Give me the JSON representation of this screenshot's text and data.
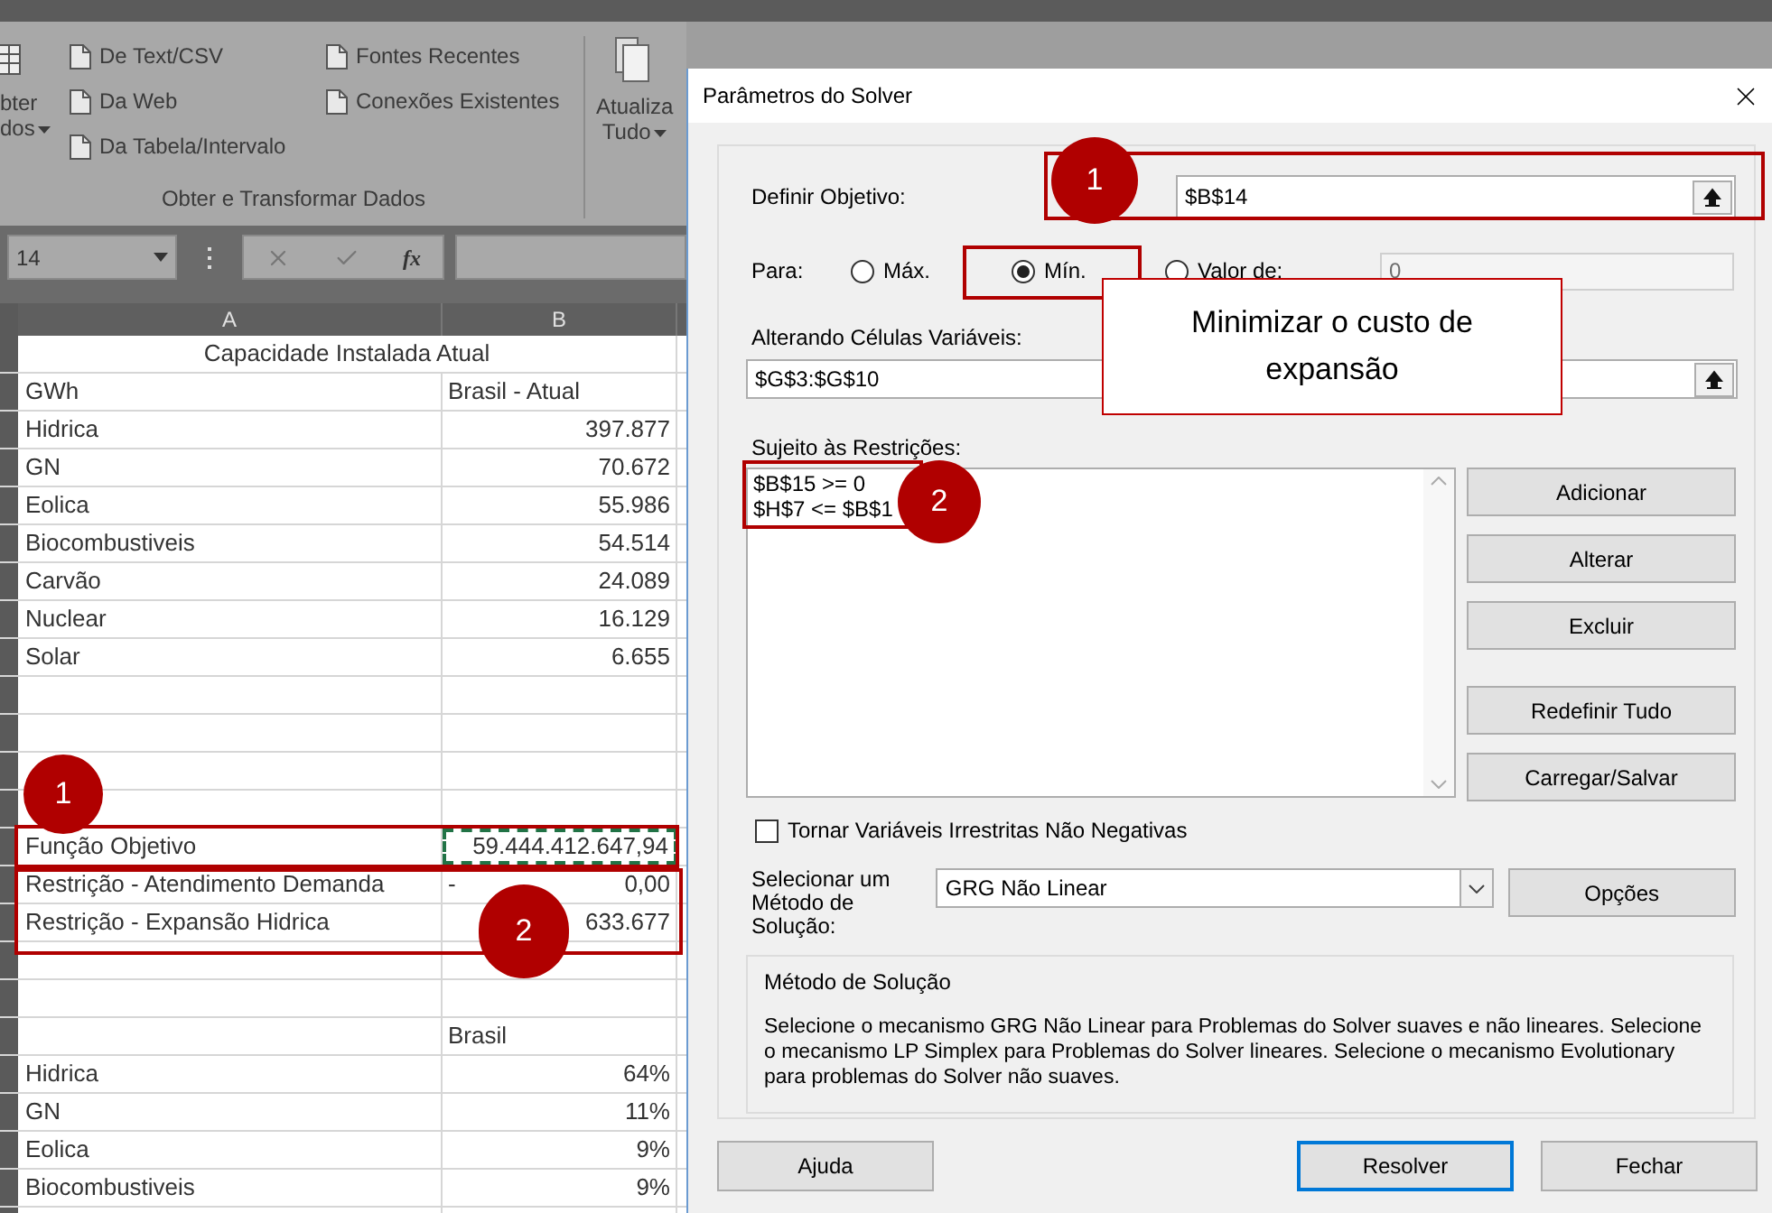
{
  "ribbon": {
    "get_data_button": [
      "bter",
      "dos"
    ],
    "import_commands": [
      {
        "label": "De Text/CSV"
      },
      {
        "label": "Da Web"
      },
      {
        "label": "Da Tabela/Intervalo"
      }
    ],
    "connection_commands": [
      {
        "label": "Fontes Recentes"
      },
      {
        "label": "Conexões Existentes"
      }
    ],
    "group_label": "Obter e Transformar Dados",
    "refresh_button": [
      "Atualiza",
      "Tudo"
    ]
  },
  "formula_bar": {
    "name_box": "14",
    "function_label": "fx"
  },
  "sheet": {
    "columns": [
      "A",
      "B"
    ],
    "rows": [
      {
        "kind": "title",
        "a": "Capacidade Instalada Atual"
      },
      {
        "kind": "header",
        "a": "GWh",
        "b": "Brasil - Atual",
        "marquee": false
      },
      {
        "kind": "cell",
        "a": "Hidrica",
        "b": "397.877",
        "marquee": false
      },
      {
        "kind": "cell",
        "a": "GN",
        "b": "70.672",
        "marquee": false
      },
      {
        "kind": "cell",
        "a": "Eolica",
        "b": "55.986",
        "marquee": false
      },
      {
        "kind": "cell",
        "a": "Biocombustiveis",
        "b": "54.514",
        "marquee": false
      },
      {
        "kind": "cell",
        "a": "Carvão",
        "b": "24.089",
        "marquee": false
      },
      {
        "kind": "cell",
        "a": "Nuclear",
        "b": "16.129",
        "marquee": false
      },
      {
        "kind": "cell",
        "a": "Solar",
        "b": "6.655",
        "marquee": false
      },
      {
        "kind": "blank"
      },
      {
        "kind": "blank"
      },
      {
        "kind": "blank"
      },
      {
        "kind": "blank"
      },
      {
        "kind": "cell",
        "a": "Função Objetivo",
        "b": "59.444.412.647,94",
        "marquee": true
      },
      {
        "kind": "cell",
        "a": "Restrição - Atendimento Demanda",
        "b_prefix": "-",
        "b": "0,00",
        "marquee": false
      },
      {
        "kind": "cell",
        "a": "Restrição - Expansão Hidrica",
        "b": "633.677",
        "marquee": false
      },
      {
        "kind": "blank"
      },
      {
        "kind": "blank"
      },
      {
        "kind": "header",
        "b": "Brasil",
        "marquee": false
      },
      {
        "kind": "cell",
        "a": "Hidrica",
        "b": "64%",
        "marquee": false
      },
      {
        "kind": "cell",
        "a": "GN",
        "b": "11%",
        "marquee": false
      },
      {
        "kind": "cell",
        "a": "Eolica",
        "b": "9%",
        "marquee": false
      },
      {
        "kind": "cell",
        "a": "Biocombustiveis",
        "b": "9%",
        "marquee": false
      },
      {
        "kind": "blank"
      }
    ]
  },
  "dialog": {
    "title": "Parâmetros do Solver",
    "objective": {
      "label": "Definir Objetivo:",
      "value": "$B$14"
    },
    "to": {
      "label": "Para:",
      "options": [
        {
          "label": "Máx.",
          "selected": false
        },
        {
          "label": "Mín.",
          "selected": true
        },
        {
          "label": "Valor de:",
          "selected": false
        }
      ],
      "value_field": {
        "value": "0",
        "disabled": true
      }
    },
    "changing": {
      "label": "Alterando Células Variáveis:",
      "value": "$G$3:$G$10"
    },
    "constraints": {
      "label": "Sujeito às Restrições:",
      "items": [
        "$B$15 >= 0",
        "$H$7 <= $B$1"
      ]
    },
    "side_buttons": [
      "Adicionar",
      "Alterar",
      "Excluir",
      "Redefinir Tudo",
      "Carregar/Salvar"
    ],
    "nonnegative": {
      "label": "Tornar Variáveis Irrestritas Não Negativas",
      "checked": false
    },
    "method": {
      "label": "Selecionar um Método de Solução:",
      "value": "GRG Não Linear"
    },
    "options_button": "Opções",
    "method_box": {
      "title": "Método de Solução",
      "text": "Selecione o mecanismo GRG Não Linear para Problemas do Solver suaves e não lineares. Selecione o mecanismo LP Simplex para Problemas do Solver lineares. Selecione o mecanismo Evolutionary para problemas do Solver não suaves."
    },
    "buttons": [
      {
        "label": "Ajuda",
        "default": false
      },
      {
        "label": "Resolver",
        "default": true
      },
      {
        "label": "Fechar",
        "default": false
      }
    ]
  },
  "annotations": [
    {
      "kind": "badge",
      "text": "1"
    },
    {
      "kind": "frame"
    },
    {
      "kind": "frame"
    },
    {
      "kind": "badge",
      "text": "2"
    },
    {
      "kind": "frame"
    },
    {
      "kind": "badge",
      "text": "1"
    },
    {
      "kind": "frame"
    },
    {
      "kind": "callout",
      "text": "Minimizar o custo de expansão"
    },
    {
      "kind": "frame"
    },
    {
      "kind": "badge",
      "text": "2"
    }
  ]
}
